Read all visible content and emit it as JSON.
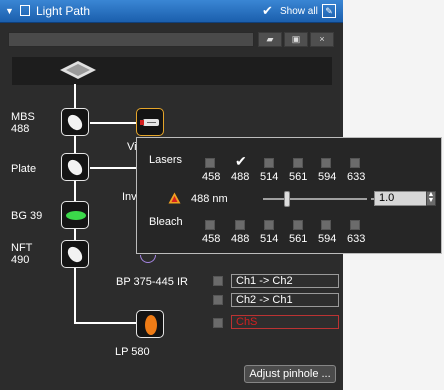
{
  "titlebar": {
    "title": "Light Path",
    "show_all": "Show all"
  },
  "toolbar": {
    "buttons": [
      "open-icon",
      "save-icon",
      "close-icon"
    ]
  },
  "optics": [
    {
      "label": "MBS\n488"
    },
    {
      "label": "Plate"
    },
    {
      "label": "BG 39"
    },
    {
      "label": "NFT\n490"
    }
  ],
  "partial_labels": {
    "vis": "Vi",
    "inv": "Inv"
  },
  "emission_filters": [
    {
      "label": "BP 375-445 IR"
    },
    {
      "label": "LP 580"
    }
  ],
  "channels": [
    {
      "label": "Ch1 -> Ch2",
      "checked": false
    },
    {
      "label": "Ch2 -> Ch1",
      "checked": false
    },
    {
      "label": "ChS",
      "checked": false,
      "color": "#d42020"
    }
  ],
  "laser_popup": {
    "lasers_label": "Lasers",
    "bleach_label": "Bleach",
    "wavelengths": [
      "458",
      "488",
      "514",
      "561",
      "594",
      "633"
    ],
    "lasers_checked": [
      false,
      true,
      false,
      false,
      false,
      false
    ],
    "bleach_checked": [
      false,
      false,
      false,
      false,
      false,
      false
    ],
    "selected_line": "488 nm",
    "power_value": "1.0",
    "warning_color": "#f0a020"
  },
  "adjust_pinhole": "Adjust pinhole ..."
}
